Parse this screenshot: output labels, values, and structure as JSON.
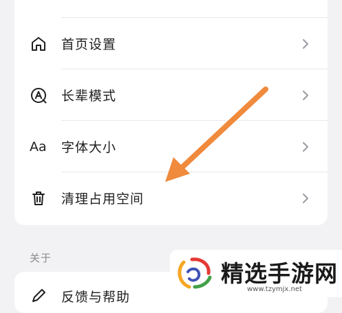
{
  "settings": {
    "items": [
      {
        "label": "首页设置",
        "icon": "home-icon"
      },
      {
        "label": "长辈模式",
        "icon": "elder-mode-icon"
      },
      {
        "label": "字体大小",
        "icon": "font-size-icon",
        "icon_text": "Aa"
      },
      {
        "label": "清理占用空间",
        "icon": "trash-icon"
      }
    ]
  },
  "about": {
    "title": "关于",
    "items": [
      {
        "label": "反馈与帮助",
        "icon": "pen-icon"
      }
    ]
  },
  "watermark": {
    "text": "精选手游网",
    "url": "www.tzymjx.net"
  },
  "colors": {
    "background": "#f2f2f4",
    "card": "#ffffff",
    "arrow": "#f08a3c",
    "chevron": "#9a9aa0",
    "section_title": "#8a8a8f"
  }
}
